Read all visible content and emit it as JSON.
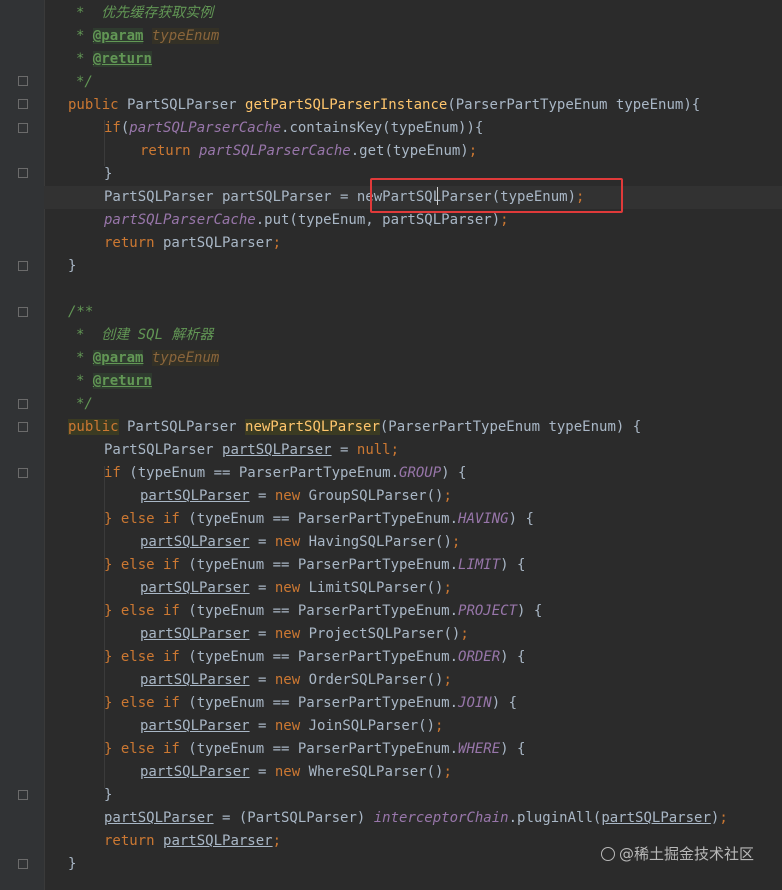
{
  "code": {
    "l1_comment": "*  优先缓存获取实例",
    "l2_star": "*",
    "l2_tag": "@param",
    "l2_param": "typeEnum",
    "l3_star": "*",
    "l3_tag": "@return",
    "l4_end": "*/",
    "l5_kw": "public",
    "l5_type": " PartSQLParser ",
    "l5_method": "getPartSQLParserInstance",
    "l5_rest": "(ParserPartTypeEnum typeEnum){",
    "l6_kw": "if",
    "l6_a": "(",
    "l6_field": "partSQLParserCache",
    "l6_rest": ".containsKey(typeEnum)){",
    "l7_kw": "return",
    "l7_sp": " ",
    "l7_field": "partSQLParserCache",
    "l7_rest": ".get(typeEnum)",
    "l7_semi": ";",
    "l8": "}",
    "l9_a": "PartSQLParser partSQLParser = ",
    "l9_b": "newPartSQLParser(typeEnum)",
    "l9_semi": ";",
    "l10_field": "partSQLParserCache",
    "l10_rest": ".put(typeEnum, partSQLParser)",
    "l10_semi": ";",
    "l11_kw": "return",
    "l11_rest": " partSQLParser",
    "l11_semi": ";",
    "l12": "}",
    "l14": "/**",
    "l15": "*  创建 SQL 解析器",
    "l16_star": "*",
    "l16_tag": "@param",
    "l16_param": "typeEnum",
    "l17_star": "*",
    "l17_tag": "@return",
    "l18": "*/",
    "l19_kw": "public",
    "l19_type": " PartSQLParser ",
    "l19_method": "newPartSQLParser",
    "l19_rest": "(ParserPartTypeEnum typeEnum) {",
    "l20_a": "PartSQLParser ",
    "l20_var": "partSQLParser",
    "l20_eq": " = ",
    "l20_null": "null",
    "l20_semi": ";",
    "var": "partSQLParser",
    "kw_if": "if",
    "kw_else": "} else if",
    "kw_new": "new",
    "cond_pre_first": " (typeEnum == ParserPartTypeEnum.",
    "cond_pre": " (typeEnum == ParserPartTypeEnum.",
    "cond_post": ") {",
    "enum_group": "GROUP",
    "enum_having": "HAVING",
    "enum_limit": "LIMIT",
    "enum_project": "PROJECT",
    "enum_order": "ORDER",
    "enum_join": "JOIN",
    "enum_where": "WHERE",
    "assign": " = ",
    "new_group": " GroupSQLParser()",
    "new_having": " HavingSQLParser()",
    "new_limit": " LimitSQLParser()",
    "new_project": " ProjectSQLParser()",
    "new_order": " OrderSQLParser()",
    "new_join": " JoinSQLParser()",
    "new_where": " WhereSQLParser()",
    "semi": ";",
    "close": "}",
    "l36_eq": " = (PartSQLParser) ",
    "l36_field": "interceptorChain",
    "l36_call": ".pluginAll(",
    "l36_end": ")",
    "l37_kw": "return",
    "l37_sp": " ",
    "l38": "}"
  },
  "watermark": "@稀土掘金技术社区"
}
